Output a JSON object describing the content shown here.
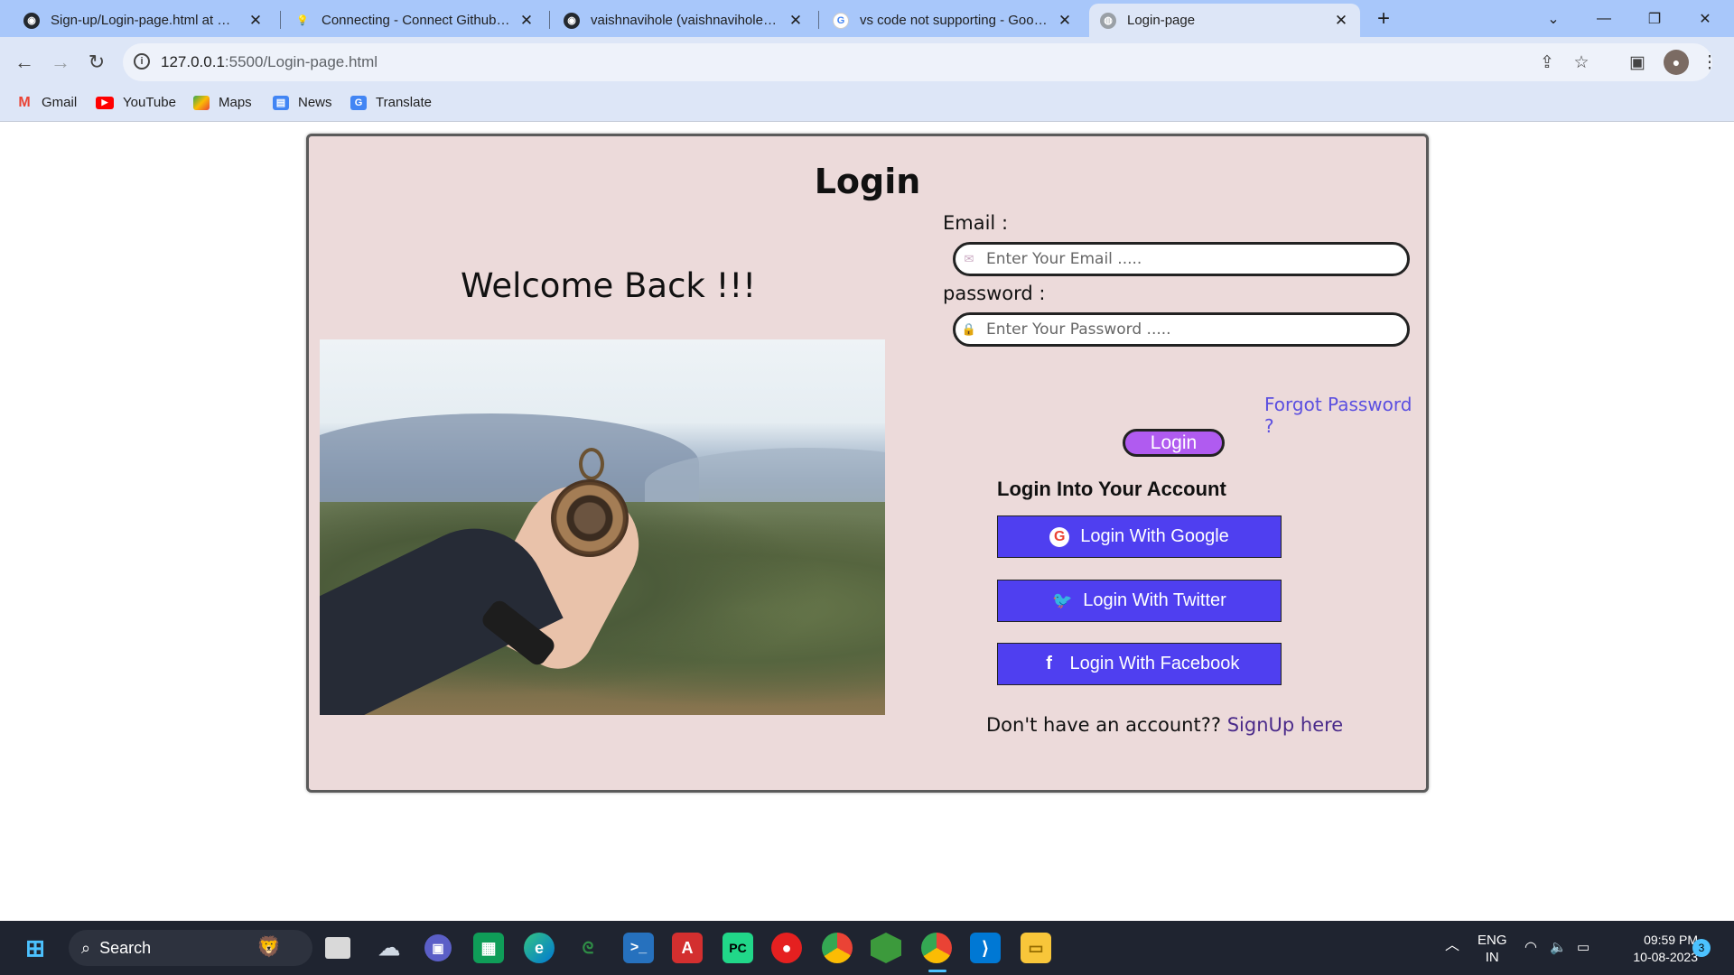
{
  "browser": {
    "tabs": [
      {
        "title": "Sign-up/Login-page.html at main",
        "icon": "github-icon"
      },
      {
        "title": "Connecting - Connect Github use",
        "icon": "bulb-icon"
      },
      {
        "title": "vaishnavihole (vaishnavihole) / R",
        "icon": "github-icon"
      },
      {
        "title": "vs code not supporting - Google",
        "icon": "google-icon"
      },
      {
        "title": "Login-page",
        "icon": "globe-icon"
      }
    ],
    "url_host": "127.0.0.1",
    "url_path": ":5500/Login-page.html",
    "bookmarks": [
      {
        "label": "Gmail",
        "icon": "gmail-icon"
      },
      {
        "label": "YouTube",
        "icon": "youtube-icon"
      },
      {
        "label": "Maps",
        "icon": "maps-icon"
      },
      {
        "label": "News",
        "icon": "news-icon"
      },
      {
        "label": "Translate",
        "icon": "translate-icon"
      }
    ]
  },
  "page": {
    "title": "Login",
    "welcome": "Welcome Back !!!",
    "email_label": "Email :",
    "email_placeholder": "Enter Your Email .....",
    "password_label": "password :",
    "password_placeholder": "Enter Your Password .....",
    "forgot": "Forgot Password ?",
    "login_button": "Login",
    "into_heading": "Login Into Your Account",
    "google_button": "Login With Google",
    "twitter_button": "Login With Twitter",
    "facebook_button": "Login With Facebook",
    "signup_prompt": "Don't have an account?? ",
    "signup_link": "SignUp here",
    "colors": {
      "card_bg": "#ecdada",
      "social_btn": "#4f3ff0",
      "login_btn": "#b05bf0",
      "link": "#5b4fe0"
    }
  },
  "taskbar": {
    "search_label": "Search",
    "lang_top": "ENG",
    "lang_bottom": "IN",
    "time": "09:59 PM",
    "date": "10-08-2023",
    "notification_count": "3"
  }
}
